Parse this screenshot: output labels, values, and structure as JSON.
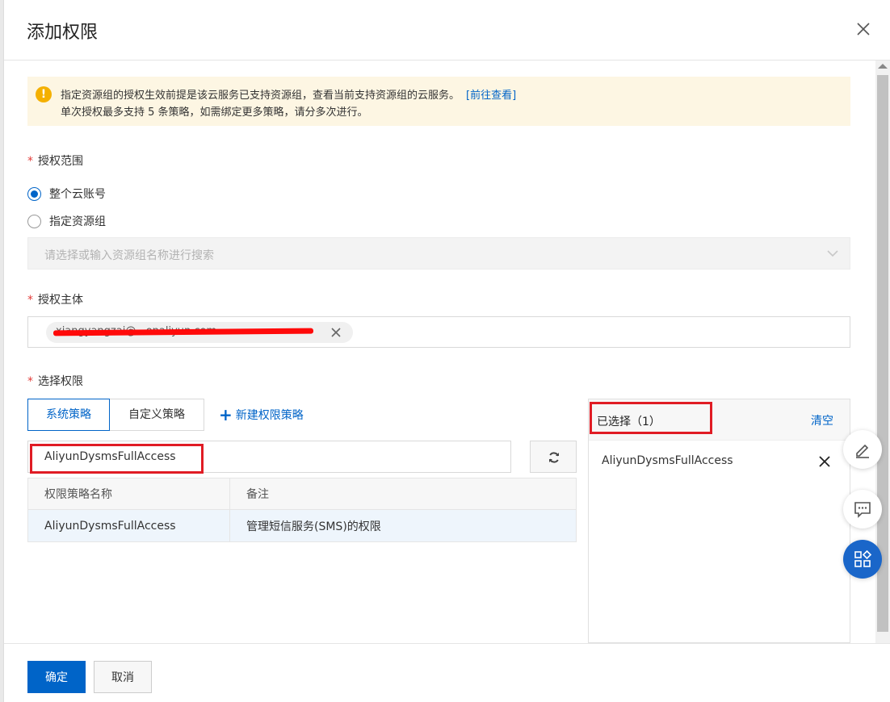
{
  "dialog": {
    "title": "添加权限"
  },
  "alert": {
    "line1": "指定资源组的授权生效前提是该云服务已支持资源组，查看当前支持资源组的云服务。",
    "link": "[前往查看]",
    "line2": "单次授权最多支持 5 条策略，如需绑定更多策略，请分多次进行。"
  },
  "scope": {
    "label": "授权范围",
    "options": [
      "整个云账号",
      "指定资源组"
    ],
    "selected_index": 0,
    "resource_group_placeholder": "请选择或输入资源组名称进行搜索"
  },
  "principal": {
    "label": "授权主体",
    "tag_text": "xiangyangzai@...onaliyun.com"
  },
  "permissions": {
    "label": "选择权限",
    "tabs": [
      "系统策略",
      "自定义策略"
    ],
    "new_policy_label": "新建权限策略",
    "search_value": "AliyunDysmsFullAccess",
    "table": {
      "columns": [
        "权限策略名称",
        "备注"
      ],
      "rows": [
        [
          "AliyunDysmsFullAccess",
          "管理短信服务(SMS)的权限"
        ]
      ]
    }
  },
  "selected": {
    "title": "已选择（1）",
    "clear_label": "清空",
    "items": [
      "AliyunDysmsFullAccess"
    ]
  },
  "footer": {
    "confirm_label": "确定",
    "cancel_label": "取消"
  },
  "colors": {
    "primary": "#0064c8",
    "required": "#e23c39",
    "highlight": "#e01c24",
    "alert_bg": "#fdf6e3",
    "warn_icon": "#f4b000"
  }
}
